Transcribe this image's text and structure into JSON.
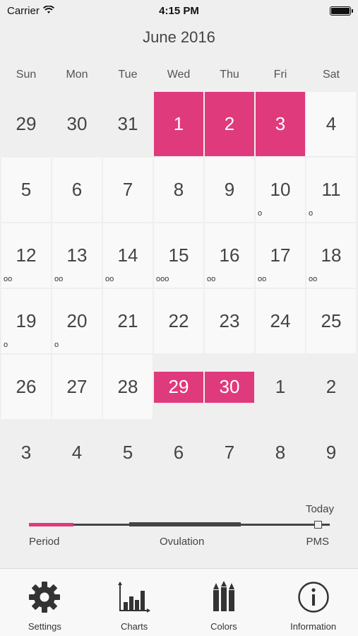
{
  "status_bar": {
    "carrier": "Carrier",
    "time": "4:15 PM",
    "icons": [
      "wifi-icon",
      "battery-icon"
    ]
  },
  "calendar": {
    "month_title": "June 2016",
    "weekdays": [
      "Sun",
      "Mon",
      "Tue",
      "Wed",
      "Thu",
      "Fri",
      "Sat"
    ],
    "days": [
      {
        "num": "29",
        "in_month": false,
        "state": "",
        "marks": ""
      },
      {
        "num": "30",
        "in_month": false,
        "state": "",
        "marks": ""
      },
      {
        "num": "31",
        "in_month": false,
        "state": "",
        "marks": ""
      },
      {
        "num": "1",
        "in_month": true,
        "state": "period",
        "marks": ""
      },
      {
        "num": "2",
        "in_month": true,
        "state": "period",
        "marks": ""
      },
      {
        "num": "3",
        "in_month": true,
        "state": "period",
        "marks": ""
      },
      {
        "num": "4",
        "in_month": true,
        "state": "",
        "marks": ""
      },
      {
        "num": "5",
        "in_month": true,
        "state": "",
        "marks": ""
      },
      {
        "num": "6",
        "in_month": true,
        "state": "",
        "marks": ""
      },
      {
        "num": "7",
        "in_month": true,
        "state": "",
        "marks": ""
      },
      {
        "num": "8",
        "in_month": true,
        "state": "",
        "marks": ""
      },
      {
        "num": "9",
        "in_month": true,
        "state": "",
        "marks": ""
      },
      {
        "num": "10",
        "in_month": true,
        "state": "",
        "marks": "o"
      },
      {
        "num": "11",
        "in_month": true,
        "state": "",
        "marks": "o"
      },
      {
        "num": "12",
        "in_month": true,
        "state": "",
        "marks": "oo"
      },
      {
        "num": "13",
        "in_month": true,
        "state": "",
        "marks": "oo"
      },
      {
        "num": "14",
        "in_month": true,
        "state": "",
        "marks": "oo"
      },
      {
        "num": "15",
        "in_month": true,
        "state": "",
        "marks": "ooo"
      },
      {
        "num": "16",
        "in_month": true,
        "state": "",
        "marks": "oo"
      },
      {
        "num": "17",
        "in_month": true,
        "state": "",
        "marks": "oo"
      },
      {
        "num": "18",
        "in_month": true,
        "state": "",
        "marks": "oo"
      },
      {
        "num": "19",
        "in_month": true,
        "state": "",
        "marks": "o"
      },
      {
        "num": "20",
        "in_month": true,
        "state": "",
        "marks": "o"
      },
      {
        "num": "21",
        "in_month": true,
        "state": "",
        "marks": ""
      },
      {
        "num": "22",
        "in_month": true,
        "state": "",
        "marks": ""
      },
      {
        "num": "23",
        "in_month": true,
        "state": "",
        "marks": ""
      },
      {
        "num": "24",
        "in_month": true,
        "state": "",
        "marks": ""
      },
      {
        "num": "25",
        "in_month": true,
        "state": "",
        "marks": ""
      },
      {
        "num": "26",
        "in_month": true,
        "state": "",
        "marks": ""
      },
      {
        "num": "27",
        "in_month": true,
        "state": "",
        "marks": ""
      },
      {
        "num": "28",
        "in_month": true,
        "state": "",
        "marks": ""
      },
      {
        "num": "29",
        "in_month": true,
        "state": "period-bar",
        "marks": ""
      },
      {
        "num": "30",
        "in_month": true,
        "state": "period-bar",
        "marks": ""
      },
      {
        "num": "1",
        "in_month": false,
        "state": "",
        "marks": ""
      },
      {
        "num": "2",
        "in_month": false,
        "state": "",
        "marks": ""
      },
      {
        "num": "3",
        "in_month": false,
        "state": "",
        "marks": ""
      },
      {
        "num": "4",
        "in_month": false,
        "state": "",
        "marks": ""
      },
      {
        "num": "5",
        "in_month": false,
        "state": "",
        "marks": ""
      },
      {
        "num": "6",
        "in_month": false,
        "state": "",
        "marks": ""
      },
      {
        "num": "7",
        "in_month": false,
        "state": "",
        "marks": ""
      },
      {
        "num": "8",
        "in_month": false,
        "state": "",
        "marks": ""
      },
      {
        "num": "9",
        "in_month": false,
        "state": "",
        "marks": ""
      }
    ]
  },
  "legend": {
    "today_label": "Today",
    "period_label": "Period",
    "ovulation_label": "Ovulation",
    "pms_label": "PMS"
  },
  "tabbar": {
    "tabs": [
      {
        "label": "Settings",
        "icon": "gear-icon"
      },
      {
        "label": "Charts",
        "icon": "bar-chart-icon"
      },
      {
        "label": "Colors",
        "icon": "pencils-icon"
      },
      {
        "label": "Information",
        "icon": "info-icon"
      }
    ]
  },
  "colors": {
    "accent": "#de3a7c",
    "background": "#efefef",
    "cell": "#f9f9f9",
    "text": "#444444"
  }
}
